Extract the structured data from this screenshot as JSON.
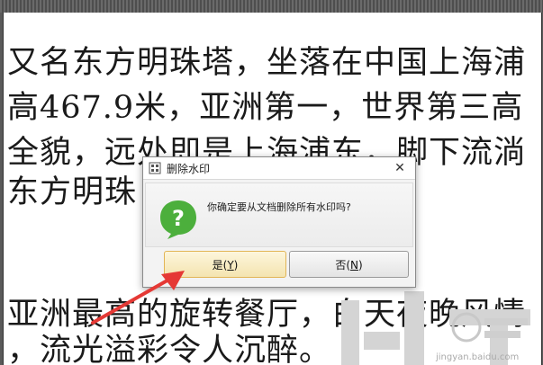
{
  "document": {
    "lines": [
      "又名东方明珠塔，坐落在中国上海浦",
      "高467.9米，亚洲第一，世界第三高",
      "全貌，远处即是上海浦东，脚下流淌",
      "东方明珠                见证了上海",
      "",
      "亚洲最高的旋转餐厅，白天夜晚风情",
      "，流光溢彩令人沉醉。"
    ],
    "watermark_badge": "jingyan.baidu.com"
  },
  "dialog": {
    "title": "删除水印",
    "close_label": "✕",
    "message": "你确定要从文档删除所有水印吗?",
    "yes_label": "是",
    "yes_hotkey": "Y",
    "no_label": "否",
    "no_hotkey": "N"
  },
  "colors": {
    "accent_yes_border": "#e2b556",
    "question_icon_green": "#4caf3c",
    "arrow_red": "#e53935"
  }
}
